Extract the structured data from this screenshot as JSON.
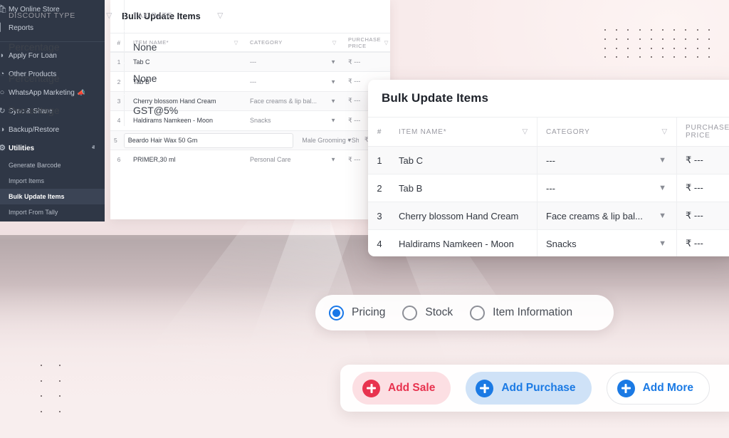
{
  "sidebar": {
    "items": [
      {
        "label": "My Online Store",
        "icon": "store-icon",
        "type": "item"
      },
      {
        "label": "Reports",
        "icon": "reports-icon",
        "type": "item"
      },
      {
        "label": "Apply For Loan",
        "icon": "loan-icon",
        "type": "item"
      },
      {
        "label": "Other Products",
        "icon": "products-icon",
        "type": "item"
      },
      {
        "label": "WhatsApp Marketing",
        "icon": "whatsapp-icon",
        "badge": "📣",
        "type": "item"
      },
      {
        "label": "Sync & Share",
        "icon": "sync-icon",
        "type": "item"
      },
      {
        "label": "Backup/Restore",
        "icon": "backup-icon",
        "chevron": "ⱟ",
        "type": "item"
      },
      {
        "label": "Utilities",
        "icon": "utilities-icon",
        "chevron": "ⱏ",
        "type": "group",
        "expanded": true
      }
    ],
    "sub_items": [
      {
        "label": "Generate Barcode",
        "selected": false
      },
      {
        "label": "Import Items",
        "selected": false
      },
      {
        "label": "Bulk Update Items",
        "selected": true
      },
      {
        "label": "Import From Tally",
        "selected": false
      }
    ]
  },
  "background_table": {
    "title": "Bulk Update Items",
    "columns": [
      {
        "label": "#",
        "filter": false
      },
      {
        "label": "ITEM NAME*",
        "filter": true
      },
      {
        "label": "CATEGORY",
        "filter": true
      },
      {
        "label": "PURCHASE PRICE",
        "filter": true
      }
    ],
    "filter_icon": "filter-funnel-icon",
    "caret_icon": "chevron-down-icon",
    "rows": [
      {
        "num": "1",
        "name": "Tab C",
        "category": "---",
        "price": "₹ ---",
        "boxed": false
      },
      {
        "num": "2",
        "name": "Tab B",
        "category": "---",
        "price": "₹ ---",
        "boxed": false
      },
      {
        "num": "3",
        "name": "Cherry blossom Hand Cream",
        "category": "Face creams & lip bal...",
        "price": "₹ ---",
        "boxed": false
      },
      {
        "num": "4",
        "name": "Haldirams  Namkeen - Moon",
        "category": "Snacks",
        "price": "₹ ---",
        "boxed": false
      },
      {
        "num": "5",
        "name": "Beardo Hair Wax 50 Gm",
        "category": "Male Grooming - Shavi...",
        "price": "₹ ---",
        "boxed": true
      },
      {
        "num": "6",
        "name": "PRIMER,30 ml",
        "category": "Personal Care",
        "price": "₹ ---",
        "boxed": false
      }
    ]
  },
  "foreground_card": {
    "title": "Bulk Update Items",
    "columns": [
      {
        "label": "#",
        "filter": false
      },
      {
        "label": "ITEM NAME*",
        "filter": true
      },
      {
        "label": "CATEGORY",
        "filter": true
      },
      {
        "label": "PURCHASE PRICE",
        "filter": false
      }
    ],
    "filter_icon": "filter-funnel-icon",
    "caret_icon": "chevron-down-icon",
    "rows": [
      {
        "num": "1",
        "name": "Tab C",
        "category": "---",
        "price": "₹ ---"
      },
      {
        "num": "2",
        "name": "Tab B",
        "category": "---",
        "price": "₹ ---"
      },
      {
        "num": "3",
        "name": "Cherry blossom Hand Cream",
        "category": "Face creams & lip bal...",
        "price": "₹ ---"
      },
      {
        "num": "4",
        "name": "Haldirams  Namkeen - Moon",
        "category": "Snacks",
        "price": "₹ ---"
      }
    ]
  },
  "discount_card": {
    "columns": [
      {
        "label": "DISCOUNT TYPE",
        "filter": true
      },
      {
        "label": "TAX RATE",
        "filter": true
      }
    ],
    "filter_icon": "filter-funnel-icon",
    "caret_icon": "chevron-down-icon",
    "rows": [
      {
        "discount_type": "Percentage",
        "tax_rate": "None"
      },
      {
        "discount_type": "Percentage",
        "tax_rate": "None"
      },
      {
        "discount_type": "Percentage",
        "tax_rate": "GST@5%"
      }
    ]
  },
  "radio_group": {
    "options": [
      {
        "label": "Pricing",
        "checked": true
      },
      {
        "label": "Stock",
        "checked": false
      },
      {
        "label": "Item Information",
        "checked": false
      }
    ]
  },
  "action_bar": {
    "buttons": [
      {
        "label": "Add Sale",
        "icon": "plus-circle-icon",
        "style": "sale"
      },
      {
        "label": "Add Purchase",
        "icon": "plus-circle-icon",
        "style": "purchase"
      },
      {
        "label": "Add More",
        "icon": "plus-circle-icon",
        "style": "more"
      }
    ]
  },
  "colors": {
    "sidebar_bg": "#2f3746",
    "sidebar_active": "#3b4455",
    "accent_blue": "#1877e8",
    "accent_red": "#e8334f",
    "sale_bg": "#fcdfe3",
    "purchase_bg": "#cfe2f7",
    "page_bg_top": "#f7ecec",
    "page_bg_mid": "#b6a9ab"
  },
  "icons": {
    "filter": "▽",
    "caret_down": "▼",
    "chevron_down": "ⱟ",
    "rupee": "₹"
  }
}
